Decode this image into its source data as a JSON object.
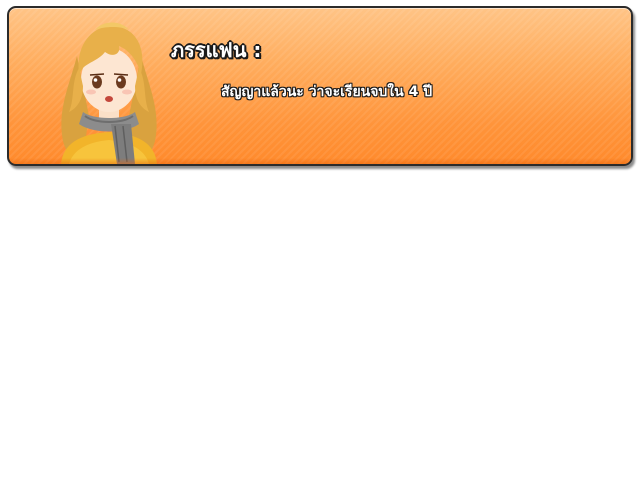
{
  "dialog": {
    "speaker_name": "ภรรแฟน :",
    "text": "สัญญาแล้วนะ ว่าจะเรียนจบใน 4 ปี",
    "portrait_icon": "girlfriend-portrait-icon"
  },
  "colors": {
    "box_top": "#ffc486",
    "box_bottom": "#ff8a2c",
    "border": "#2b2b2b",
    "text": "#ffffff",
    "text_outline": "#1a1a1a"
  }
}
